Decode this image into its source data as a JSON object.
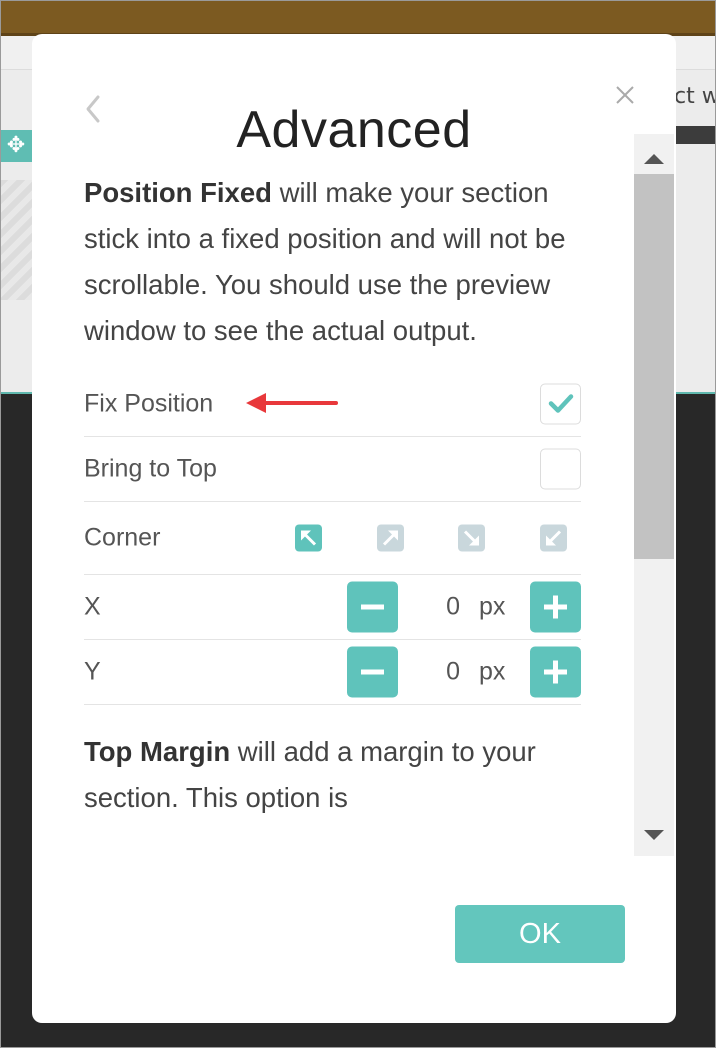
{
  "background": {
    "move_icon_glyph": "✥",
    "right_text": "ct w"
  },
  "modal": {
    "title": "Advanced",
    "intro_bold": "Position Fixed",
    "intro_rest": " will make your section stick into a fixed position and will not be scrollable. You should use the preview window to see the actual output.",
    "fix_position": {
      "label": "Fix Position",
      "checked": true
    },
    "bring_to_top": {
      "label": "Bring to Top",
      "checked": false
    },
    "corner": {
      "label": "Corner",
      "options": [
        {
          "name": "top-left",
          "active": true
        },
        {
          "name": "top-right",
          "active": false
        },
        {
          "name": "bottom-right",
          "active": false
        },
        {
          "name": "bottom-left",
          "active": false
        }
      ]
    },
    "x": {
      "label": "X",
      "value": "0",
      "unit": "px"
    },
    "y": {
      "label": "Y",
      "value": "0",
      "unit": "px"
    },
    "margin_bold": "Top Margin",
    "margin_rest": " will add a margin to your section. This option is",
    "ok_label": "OK"
  },
  "colors": {
    "accent": "#63c6bd",
    "annotation_arrow": "#e8383b",
    "inactive_corner": "#c9d7dc"
  },
  "icons": {
    "back": "chevron-left-icon",
    "close": "close-icon",
    "check": "checkmark-icon",
    "minus": "minus-icon",
    "plus": "plus-icon"
  }
}
